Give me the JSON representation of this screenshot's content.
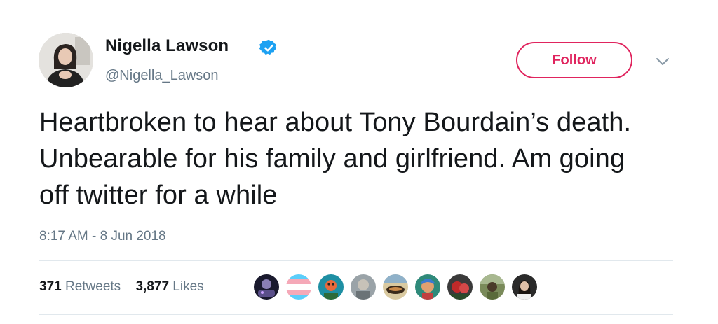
{
  "tweet": {
    "author": {
      "display_name": "Nigella Lawson",
      "handle": "@Nigella_Lawson",
      "verified": true,
      "avatar_icon": "profile-photo"
    },
    "follow_label": "Follow",
    "text": "Heartbroken to hear about Tony Bourdain’s death. Unbearable for his family and girlfriend. Am going off twitter for a while",
    "timestamp": "8:17 AM - 8 Jun 2018",
    "stats": {
      "retweets_count": "371",
      "retweets_label": "Retweets",
      "likes_count": "3,877",
      "likes_label": "Likes"
    },
    "liker_avatar_count": 9
  },
  "colors": {
    "accent": "#e0245e",
    "verified": "#1da1f2",
    "secondary_text": "#657786",
    "primary_text": "#14171a",
    "divider": "#e1e8ed"
  }
}
